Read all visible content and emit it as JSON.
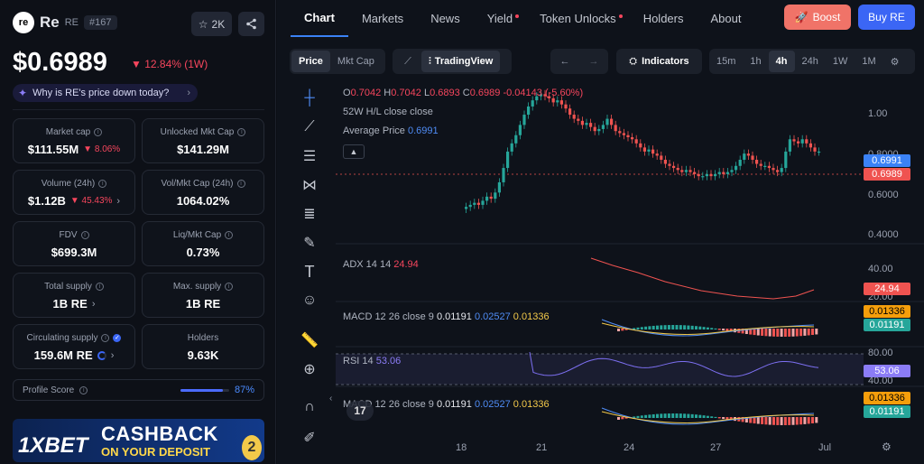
{
  "coin": {
    "logo_text": "re",
    "name": "Re",
    "symbol": "RE",
    "rank": "#167",
    "stars": "2K",
    "price": "$0.6989",
    "price_change": "▼ 12.84% (1W)",
    "why_text": "Why is RE's price down today?"
  },
  "stats": [
    {
      "label": "Market cap",
      "value": "$111.55M",
      "change": "▼ 8.06%"
    },
    {
      "label": "Unlocked Mkt Cap",
      "value": "$141.29M"
    },
    {
      "label": "Volume (24h)",
      "value": "$1.12B",
      "change": "▼ 45.43%"
    },
    {
      "label": "Vol/Mkt Cap (24h)",
      "value": "1064.02%"
    },
    {
      "label": "FDV",
      "value": "$699.3M"
    },
    {
      "label": "Liq/Mkt Cap",
      "value": "0.73%"
    },
    {
      "label": "Total supply",
      "value": "1B RE"
    },
    {
      "label": "Max. supply",
      "value": "1B RE"
    },
    {
      "label": "Circulating supply",
      "value": "159.6M RE"
    },
    {
      "label": "Holders",
      "value": "9.63K"
    }
  ],
  "profile": {
    "label": "Profile Score",
    "value": "87%",
    "score": 0.87
  },
  "banner": {
    "brand": "1XBET",
    "headline": "CASHBACK",
    "subline": "ON YOUR DEPOSIT"
  },
  "nav": {
    "tabs": [
      "Chart",
      "Markets",
      "News",
      "Yield",
      "Token Unlocks",
      "Holders",
      "About"
    ],
    "active_tab": "Chart",
    "boost": "Boost",
    "buy": "Buy RE"
  },
  "toolbar": {
    "price": "Price",
    "mktcap": "Mkt Cap",
    "tradingview": "TradingView",
    "indicators": "Indicators",
    "timeframes": [
      "15m",
      "1h",
      "4h",
      "24h",
      "1W",
      "1M"
    ],
    "active_timeframe": "4h"
  },
  "ohlc": {
    "o_label": "O",
    "o": "0.7042",
    "h_label": "H",
    "h": "0.7042",
    "l_label": "L",
    "l": "0.6893",
    "c_label": "C",
    "c": "0.6989",
    "change": "-0.04143 (-5.60%)"
  },
  "legend": {
    "hl": "52W H/L close close",
    "avg_label": "Average Price",
    "avg_value": "0.6991",
    "adx_label": "ADX 14 14",
    "adx_value": "24.94",
    "macd_label": "MACD 12 26 close 9",
    "macd_v1": "0.01191",
    "macd_v2": "0.02527",
    "macd_v3": "0.01336",
    "rsi_label": "RSI 14",
    "rsi_value": "53.06",
    "macd2_label": "MACD 12 26 close 9",
    "macd2_v1": "0.01191",
    "macd2_v2": "0.02527",
    "macd2_v3": "0.01336"
  },
  "price_axis": [
    "1.00",
    "0.8000",
    "0.6000",
    "0.4000"
  ],
  "price_tags": {
    "avg": "0.6991",
    "last": "0.6989"
  },
  "adx_axis": [
    "40.00",
    "20.00"
  ],
  "adx_tag": "24.94",
  "macd_tags": [
    "0.01336",
    "0.01191"
  ],
  "rsi_axis": [
    "80.00",
    "40.00"
  ],
  "rsi_tag": "53.06",
  "macd2_tags": [
    "0.01336",
    "0.01191"
  ],
  "x_axis": [
    "18",
    "21",
    "24",
    "27",
    "Jul"
  ],
  "tv_badge": "17",
  "colors": {
    "up": "#26a69a",
    "down": "#ef5350",
    "accent": "#3b66f5",
    "boost": "#f07368"
  }
}
